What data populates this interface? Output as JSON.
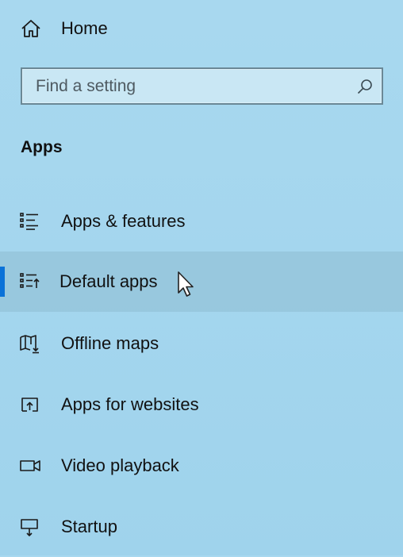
{
  "home": {
    "label": "Home",
    "icon": "home-icon"
  },
  "search": {
    "placeholder": "Find a setting",
    "value": "",
    "icon": "search-icon"
  },
  "section": {
    "title": "Apps"
  },
  "nav": {
    "items": [
      {
        "label": "Apps & features",
        "icon": "apps-features-icon",
        "selected": false
      },
      {
        "label": "Default apps",
        "icon": "default-apps-icon",
        "selected": true
      },
      {
        "label": "Offline maps",
        "icon": "offline-maps-icon",
        "selected": false
      },
      {
        "label": "Apps for websites",
        "icon": "apps-for-websites-icon",
        "selected": false
      },
      {
        "label": "Video playback",
        "icon": "video-playback-icon",
        "selected": false
      },
      {
        "label": "Startup",
        "icon": "startup-icon",
        "selected": false
      }
    ]
  },
  "colors": {
    "background": "#a4d6ee",
    "accent": "#0a72d8",
    "selected_row": "#8fbcd2",
    "search_border": "#6b8896"
  }
}
